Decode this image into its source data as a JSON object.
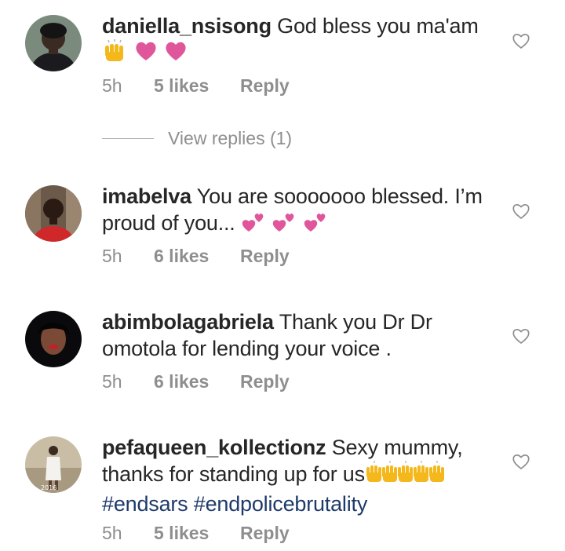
{
  "comments": [
    {
      "username": "daniella_nsisong",
      "text": "God bless you ma'am",
      "emoji_desc": "raised-hands-and-hearts",
      "time": "5h",
      "likes": "5 likes",
      "reply": "Reply"
    },
    {
      "username": "imabelva",
      "text": "You are sooooooo blessed. I’m proud of you...",
      "emoji_desc": "two-hearts",
      "time": "5h",
      "likes": "6 likes",
      "reply": "Reply"
    },
    {
      "username": "abimbolagabriela",
      "text": "Thank you Dr Dr omotola for lending your voice .",
      "time": "5h",
      "likes": "6 likes",
      "reply": "Reply"
    },
    {
      "username": "pefaqueen_kollectionz",
      "text": "Sexy mummy, thanks for standing up for us",
      "emoji_desc": "raised-hands",
      "hashtags": "#endsars #endpolicebrutality",
      "time": "5h",
      "likes": "5 likes",
      "reply": "Reply"
    }
  ],
  "view_replies": "View replies (1)",
  "avatar_caption": "2016",
  "icons": {
    "like": "heart-outline-icon"
  },
  "colors": {
    "text": "#262626",
    "meta": "#8e8e8e",
    "hashtag": "#1e3a6b",
    "heart_emoji": "#e0569a",
    "hands_emoji": "#f5b81c"
  }
}
